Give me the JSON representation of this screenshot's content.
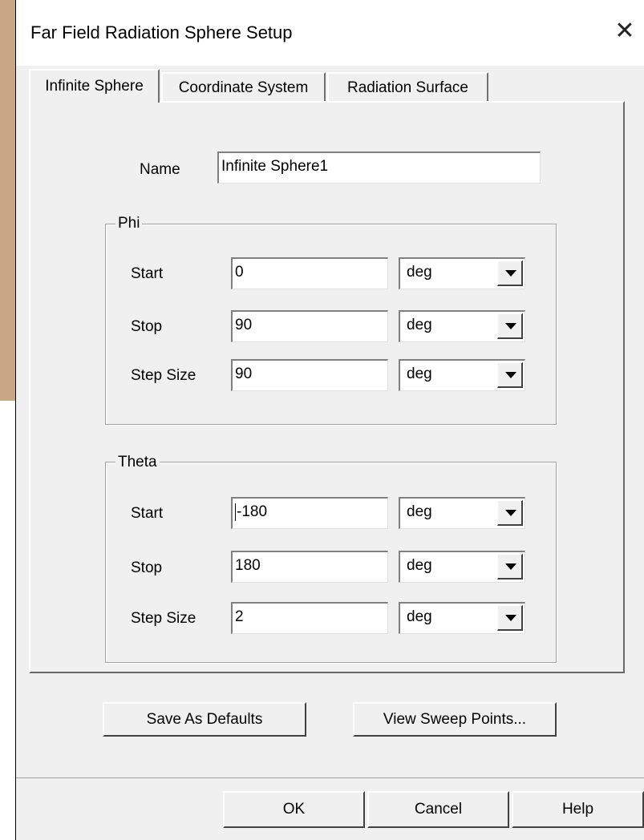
{
  "window": {
    "title": "Far Field Radiation Sphere Setup",
    "close_glyph": "✕"
  },
  "tabs": [
    {
      "label": "Infinite Sphere",
      "active": true
    },
    {
      "label": "Coordinate System",
      "active": false
    },
    {
      "label": "Radiation Surface",
      "active": false
    }
  ],
  "name_field": {
    "label": "Name",
    "value": "Infinite Sphere1"
  },
  "phi": {
    "title": "Phi",
    "rows": [
      {
        "label": "Start",
        "value": "0",
        "unit": "deg"
      },
      {
        "label": "Stop",
        "value": "90",
        "unit": "deg"
      },
      {
        "label": "Step Size",
        "value": "90",
        "unit": "deg"
      }
    ]
  },
  "theta": {
    "title": "Theta",
    "rows": [
      {
        "label": "Start",
        "value": "-180",
        "unit": "deg"
      },
      {
        "label": "Stop",
        "value": "180",
        "unit": "deg"
      },
      {
        "label": "Step Size",
        "value": "2",
        "unit": "deg"
      }
    ]
  },
  "buttons": {
    "save_defaults": "Save As Defaults",
    "view_sweep": "View Sweep Points...",
    "ok": "OK",
    "cancel": "Cancel",
    "help": "Help"
  },
  "colors": {
    "dialog_bg": "#f0f0f0",
    "title_bg": "#ffffff"
  },
  "icons": [
    "close-icon",
    "dropdown-arrow-icon"
  ]
}
